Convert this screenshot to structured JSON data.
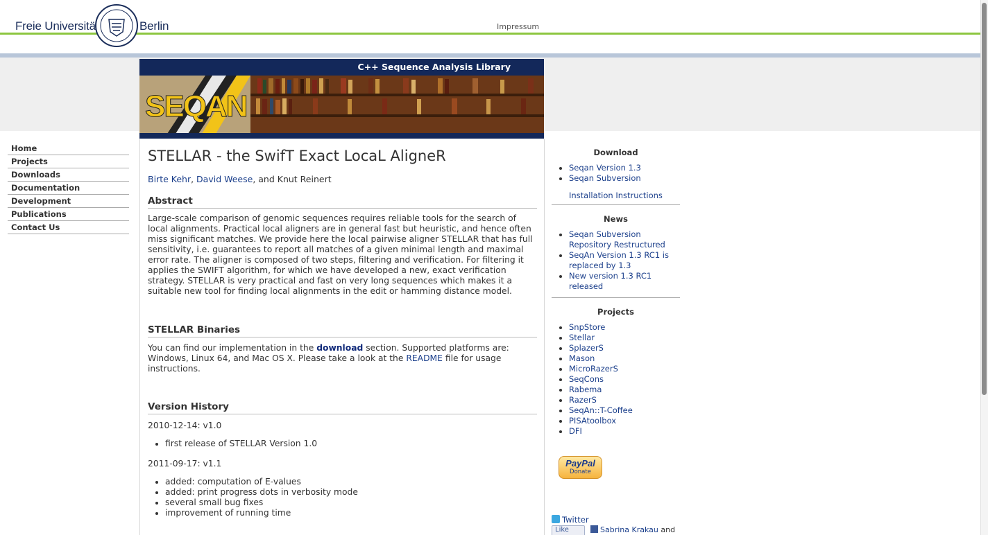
{
  "header": {
    "brand_left": "Freie Universität",
    "brand_right": "Berlin",
    "impressum": "Impressum"
  },
  "banner": {
    "tagline": "C++ Sequence Analysis Library",
    "logo_text": "SEQAN"
  },
  "nav": {
    "items": [
      "Home",
      "Projects",
      "Downloads",
      "Documentation",
      "Development",
      "Publications",
      "Contact Us"
    ]
  },
  "main": {
    "title": "STELLAR - the SwifT Exact LocaL AligneR",
    "authors": {
      "author1": "Birte Kehr",
      "sep1": ", ",
      "author2": "David Weese",
      "rest": ", and Knut Reinert"
    },
    "abstract_heading": "Abstract",
    "abstract_text": "Large-scale comparison of genomic sequences requires reliable tools for the search of local alignments. Practical local aligners are in general fast but heuristic, and hence often miss significant matches. We provide here the local pairwise aligner STELLAR that has full sensitivity, i.e. guarantees to report all matches of a given minimal length and maximal error rate. The aligner is composed of two steps, filtering and verification. For filtering it applies the SWIFT algorithm, for which we have developed a new, exact verification strategy. STELLAR is very practical and fast on very long sequences which makes it a suitable new tool for finding local alignments in the edit or hamming distance model.",
    "binaries_heading": "STELLAR Binaries",
    "binaries": {
      "t1": "You can find our implementation in the ",
      "download_link": "download",
      "t2": " section. Supported platforms are: Windows, Linux 64, and Mac OS X. Please take a look at the ",
      "readme_link": "README",
      "t3": " file for usage instructions."
    },
    "history_heading": "Version History",
    "versions": [
      {
        "label": "2010-12-14: v1.0",
        "items": [
          "first release of STELLAR Version 1.0"
        ]
      },
      {
        "label": "2011-09-17: v1.1",
        "items": [
          "added: computation of E-values",
          "added: print progress dots in verbosity mode",
          "several small bug fixes",
          "improvement of running time"
        ]
      }
    ]
  },
  "sidebar": {
    "download": {
      "heading": "Download",
      "items": [
        "Seqan Version 1.3",
        "Seqan Subversion"
      ],
      "install_link": "Installation Instructions"
    },
    "news": {
      "heading": "News",
      "items": [
        "Seqan Subversion Repository Restructured",
        "SeqAn Version 1.3 RC1 is replaced by 1.3",
        "New version 1.3 RC1 released"
      ]
    },
    "projects": {
      "heading": "Projects",
      "items": [
        "SnpStore",
        "Stellar",
        "SplazerS",
        "Mason",
        "MicroRazerS",
        "SeqCons",
        "Rabema",
        "RazerS",
        "SeqAn::T-Coffee",
        "PISAtoolbox",
        "DFI"
      ]
    },
    "paypal": {
      "logo": "PayPal",
      "label": "Donate"
    },
    "twitter": "Twitter",
    "like": "Like",
    "friends": "Sabrina Krakau",
    "friends_suffix": " and"
  },
  "colors": {
    "accent_green": "#8cc63f",
    "banner_navy": "#13285a",
    "link_blue": "#1b3f8b",
    "logo_yellow": "#f2c318"
  }
}
